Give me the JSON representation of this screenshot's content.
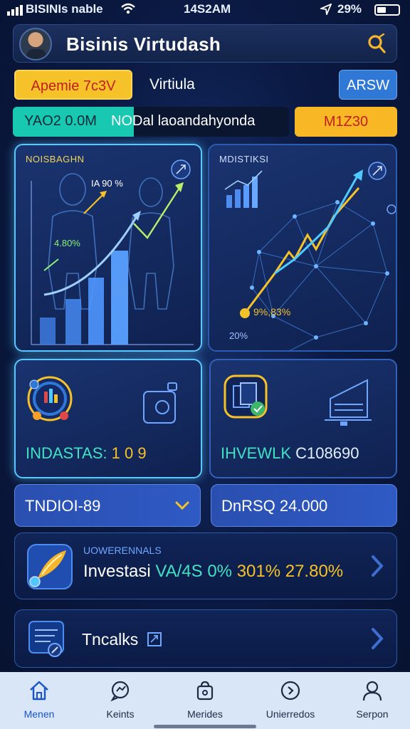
{
  "status_bar": {
    "carrier": "BISINIs nable",
    "time": "14S2AM",
    "battery": "29%"
  },
  "header": {
    "title": "Bisinis Virtudash"
  },
  "filters": {
    "primary_pill": "Apemie 7c3V",
    "label": "Virtiula",
    "button": "ARSW"
  },
  "stats": {
    "teal_text": "YAO2 0.0M",
    "dark_text": "NODal laoandahyonda",
    "orange_text": "M1Z30"
  },
  "cards": {
    "chart1": {
      "label": "NOISBAGHN",
      "annotation_top": "IA 90 %",
      "annotation_mid": "4.80%"
    },
    "chart2": {
      "label": "MDISTIKSI",
      "annotation_main": "9%,83%",
      "annotation_sub": "20%"
    },
    "industry": {
      "label": "INDASTAS:",
      "value": "1 0 9"
    },
    "invest_card": {
      "label": "IHVEWLK",
      "value": "C108690"
    }
  },
  "dropdowns": {
    "left": "TNDIOI-89",
    "right": "DnRSQ 24.000"
  },
  "investment_item": {
    "subtitle": "UOWERENNALS",
    "title": "Investasi",
    "teal_part": "VA/4S 0%",
    "gold_part": "301% 27.80%"
  },
  "tools_item": {
    "title": "Tncalks"
  },
  "nav": [
    {
      "label": "Menen",
      "icon": "home-icon"
    },
    {
      "label": "Keints",
      "icon": "chat-icon"
    },
    {
      "label": "Merides",
      "icon": "bag-icon"
    },
    {
      "label": "Unierredos",
      "icon": "compass-icon"
    },
    {
      "label": "Serpon",
      "icon": "profile-icon"
    }
  ],
  "colors": {
    "accent_teal": "#42e1c4",
    "accent_gold": "#f6c22a",
    "background": "#0b1a44",
    "nav_bg": "#d8e6f7"
  }
}
